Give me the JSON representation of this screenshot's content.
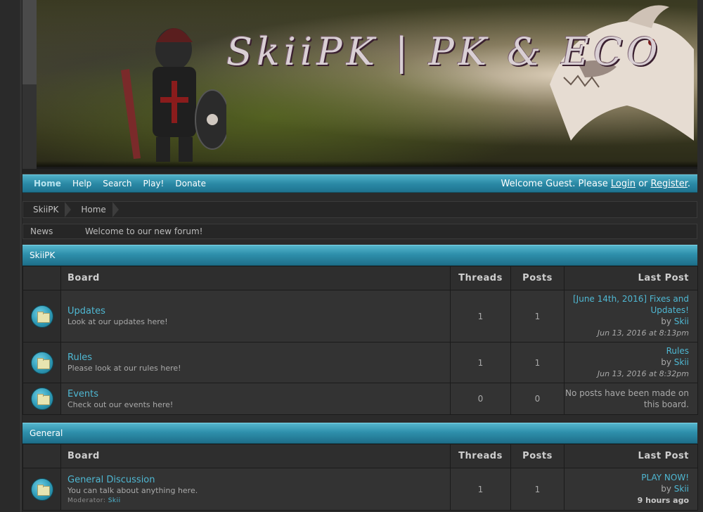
{
  "banner": {
    "title": "SkiiPK | PK & ECO"
  },
  "nav": {
    "items": [
      "Home",
      "Help",
      "Search",
      "Play!",
      "Donate"
    ],
    "welcome_prefix": "Welcome Guest. Please ",
    "login": "Login",
    "or": " or ",
    "register": "Register",
    "suffix": "."
  },
  "breadcrumb": [
    "SkiiPK",
    "Home"
  ],
  "news": {
    "label": "News",
    "text": "Welcome to our new forum!"
  },
  "columns": {
    "board": "Board",
    "threads": "Threads",
    "posts": "Posts",
    "last_post": "Last Post"
  },
  "categories": [
    {
      "name": "SkiiPK",
      "boards": [
        {
          "name": "Updates",
          "description": "Look at our updates here!",
          "threads": "1",
          "posts": "1",
          "last_title": "[June 14th, 2016] Fixes and Updates!",
          "last_by": "by ",
          "last_author": "Skii",
          "last_date": "Jun 13, 2016 at 8:13pm"
        },
        {
          "name": "Rules",
          "description": "Please look at our rules here!",
          "threads": "1",
          "posts": "1",
          "last_title": "Rules",
          "last_by": "by ",
          "last_author": "Skii",
          "last_date": "Jun 13, 2016 at 8:32pm"
        },
        {
          "name": "Events",
          "description": "Check out our events here!",
          "threads": "0",
          "posts": "0",
          "last_none": "No posts have been made on this board."
        }
      ]
    },
    {
      "name": "General",
      "boards": [
        {
          "name": "General Discussion",
          "description": "You can talk about anything here.",
          "moderator_label": "Moderator: ",
          "moderator": "Skii",
          "threads": "1",
          "posts": "1",
          "last_title": "PLAY NOW!",
          "last_by": "by ",
          "last_author": "Skii",
          "last_date": "9 hours ago"
        }
      ]
    }
  ],
  "colors": {
    "accent": "#2b8aa6",
    "link": "#4fb8d3",
    "background": "#2b2b2b"
  }
}
